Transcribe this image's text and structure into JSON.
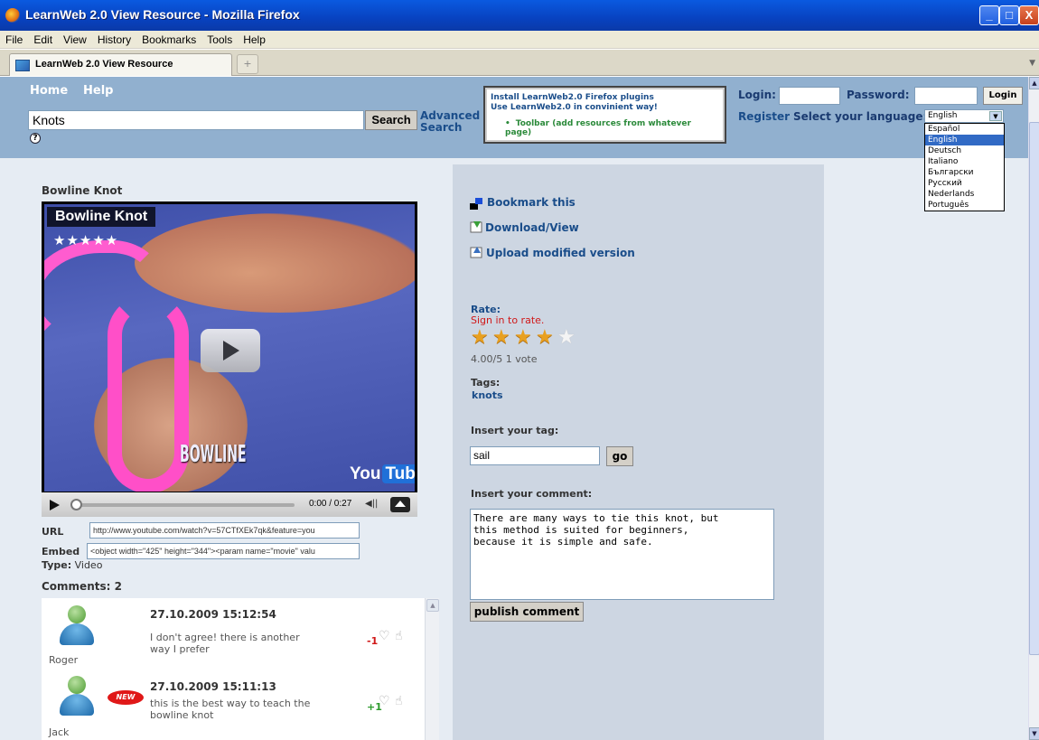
{
  "window": {
    "title": "LearnWeb 2.0 View Resource - Mozilla Firefox",
    "min_label": "_",
    "max_label": "□",
    "close_label": "X"
  },
  "menu": [
    "File",
    "Edit",
    "View",
    "History",
    "Bookmarks",
    "Tools",
    "Help"
  ],
  "tabs": {
    "active_label": "LearnWeb 2.0 View Resource",
    "new_tab_label": "+"
  },
  "header": {
    "home": "Home",
    "help": "Help",
    "search_value": "Knots",
    "search_button": "Search",
    "advanced_search_1": "Advanced",
    "advanced_search_2": "Search",
    "help_icon_glyph": "?",
    "plugins": {
      "line1": "Install LearnWeb2.0 Firefox plugins",
      "line2": "Use LearnWeb2.0 in convinient way!",
      "item": "Toolbar (add resources from whatever page)"
    },
    "login_label": "Login:",
    "password_label": "Password:",
    "login_button": "Login",
    "register": "Register",
    "select_language_label": "Select your language:",
    "language_selected": "English",
    "language_options": [
      "Español",
      "English",
      "Deutsch",
      "Italiano",
      "Български",
      "Русский",
      "Nederlands",
      "Português"
    ]
  },
  "resource": {
    "title": "Bowline Knot",
    "video": {
      "overlay_title": "Bowline Knot",
      "overlay_stars": "★★★★★",
      "caption": "BOWLINE",
      "brand_you": "You",
      "brand_tube": "Tube",
      "time": "0:00 / 0:27"
    },
    "url_label": "URL",
    "url_value": "http://www.youtube.com/watch?v=57CTfXEk7qk&feature=you",
    "embed_label": "Embed",
    "embed_value": "<object width=\"425\" height=\"344\"><param name=\"movie\" valu",
    "type_label": "Type:",
    "type_value": "Video",
    "comments_heading": "Comments: 2",
    "comments": [
      {
        "user": "Roger",
        "date": "27.10.2009 15:12:54",
        "text": "I don't agree! there is another way I prefer",
        "score": "-1",
        "score_color": "#d01818"
      },
      {
        "user": "Jack",
        "date": "27.10.2009 15:11:13",
        "text": "this is the best way to teach the bowline knot",
        "score": "+1",
        "score_color": "#2b9a2b",
        "badge": "NEW"
      }
    ]
  },
  "actions": {
    "bookmark": "Bookmark this",
    "download": "Download/View",
    "upload": "Upload modified version"
  },
  "rating": {
    "label": "Rate:",
    "signin": "Sign in to rate.",
    "value": 4,
    "max": 5,
    "score_text": "4.00/5 1 vote"
  },
  "tags": {
    "label": "Tags:",
    "items": [
      "knots"
    ],
    "insert_label": "Insert your tag:",
    "input_value": "sail",
    "go_button": "go"
  },
  "comment_form": {
    "label": "Insert your comment:",
    "text": "There are many ways to tie this knot, but\nthis method is suited for beginners,\nbecause it is simple and safe.",
    "publish_button": "publish comment"
  },
  "colors": {
    "header_bg": "#91b0cf",
    "page_bg": "#e6ecf3",
    "link": "#1a4d8a",
    "star_on": "#e8a020"
  }
}
